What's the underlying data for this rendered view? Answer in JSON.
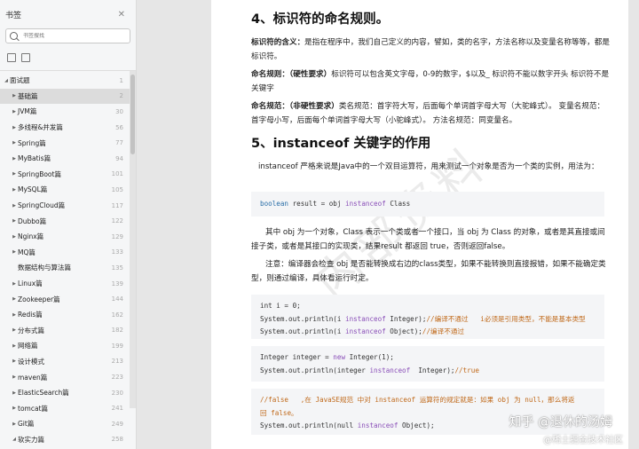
{
  "sidebar": {
    "title": "书签",
    "search_placeholder": "书签搜找",
    "items": [
      {
        "label": "面试题",
        "page": "1"
      },
      {
        "label": "基础篇",
        "page": "2"
      },
      {
        "label": "JVM篇",
        "page": "30"
      },
      {
        "label": "多线程&并发篇",
        "page": "56"
      },
      {
        "label": "Spring篇",
        "page": "77"
      },
      {
        "label": "MyBatis篇",
        "page": "94"
      },
      {
        "label": "SpringBoot篇",
        "page": "101"
      },
      {
        "label": "MySQL篇",
        "page": "105"
      },
      {
        "label": "SpringCloud篇",
        "page": "117"
      },
      {
        "label": "Dubbo篇",
        "page": "122"
      },
      {
        "label": "Nginx篇",
        "page": "129"
      },
      {
        "label": "MQ篇",
        "page": "133"
      },
      {
        "label": "数据结构与算法篇",
        "page": "135"
      },
      {
        "label": "Linux篇",
        "page": "139"
      },
      {
        "label": "Zookeeper篇",
        "page": "144"
      },
      {
        "label": "Redis篇",
        "page": "162"
      },
      {
        "label": "分布式篇",
        "page": "182"
      },
      {
        "label": "网络篇",
        "page": "199"
      },
      {
        "label": "设计模式",
        "page": "213"
      },
      {
        "label": "maven篇",
        "page": "223"
      },
      {
        "label": "ElasticSearch篇",
        "page": "230"
      },
      {
        "label": "tomcat篇",
        "page": "241"
      },
      {
        "label": "Git篇",
        "page": "249"
      },
      {
        "label": "软实力篇",
        "page": "258"
      }
    ]
  },
  "doc": {
    "heading4": "4、标识符的命名规则。",
    "p1_bold": "标识符的含义：",
    "p1_text": "是指在程序中，我们自己定义的内容，譬如，类的名字，方法名称以及变量名称等等，都是标识符。",
    "p2_bold": "命名规则：（硬性要求）",
    "p2_text": "标识符可以包含英文字母，0-9的数字，$以及_ 标识符不能以数字开头 标识符不是关键字",
    "p3_bold": "命名规范：（非硬性要求）",
    "p3_text": "类名规范：首字符大写，后面每个单词首字母大写（大驼峰式）。 变量名规范：首字母小写，后面每个单词首字母大写（小驼峰式）。 方法名规范：同变量名。",
    "heading5": "5、instanceof 关键字的作用",
    "p4": "instanceof 严格来说是Java中的一个双目运算符，用来测试一个对象是否为一个类的实例，用法为：",
    "code1_kw": "boolean",
    "code1_a": " result = obj ",
    "code1_kw2": "instanceof",
    "code1_b": " Class",
    "p5": "其中 obj 为一个对象，Class 表示一个类或者一个接口，当 obj 为 Class 的对象，或者是其直接或间接子类，或者是其接口的实现类，结果result 都返回 true，否则返回false。",
    "p6": "注意：编译器会检查 obj 是否能转换成右边的class类型，如果不能转换则直接报错，如果不能确定类型，则通过编译，具体看运行时定。",
    "code2_l1": "int i = 0;",
    "code2_l2a": "System.out.println(i ",
    "code2_l2kw": "instanceof",
    "code2_l2b": " Integer);",
    "code2_l2c": "//编译不通过   i必须是引用类型，不能是基本类型",
    "code2_l3a": "System.out.println(i ",
    "code2_l3kw": "instanceof",
    "code2_l3b": " Object);",
    "code2_l3c": "//编译不通过",
    "code3_l1a": "Integer integer = ",
    "code3_l1kw": "new",
    "code3_l1b": " Integer(1);",
    "code3_l2a": "System.out.println(integer ",
    "code3_l2kw": "instanceof",
    "code3_l2b": "  Integer);",
    "code3_l2c": "//true",
    "code4_l1": "//false   ,在 JavaSE规范 中对 instanceof 运算符的规定就是：如果 obj 为 null，那么将返",
    "code4_l2": "回 false。",
    "code4_l3a": "System.out.println(null ",
    "code4_l3kw": "instanceof",
    "code4_l3b": " Object);",
    "watermark": "内部资料",
    "zhihu": "知乎 @退休的汤姆",
    "zhihu2": "@稀土掘金技术社区"
  },
  "colors": {
    "sidebar_bg": "#f5f6f7",
    "active_row": "#dcdcdc",
    "keyword": "#8a4fb8",
    "comment": "#c0691a"
  }
}
